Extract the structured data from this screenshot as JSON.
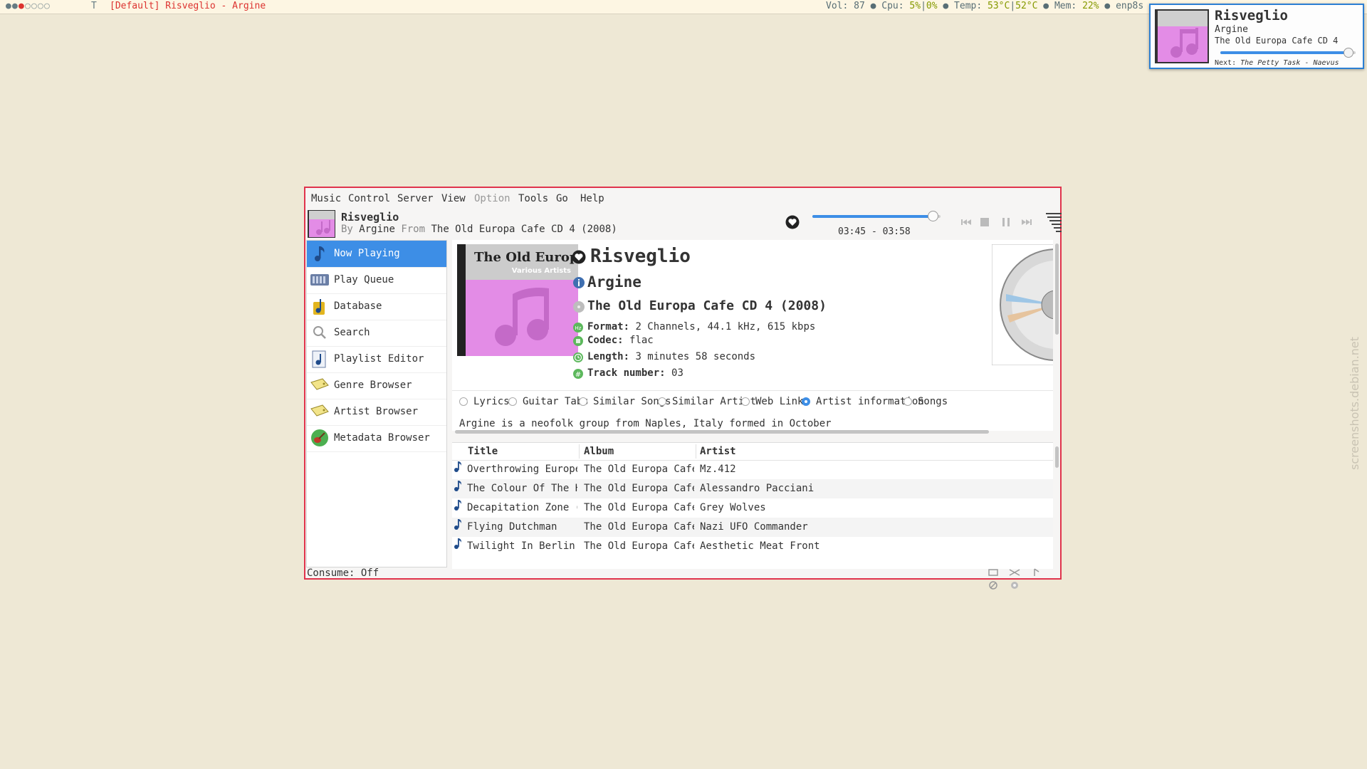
{
  "topbar": {
    "workspaces": [
      "●",
      "●",
      "●",
      "○",
      "○",
      "○",
      "○"
    ],
    "layout": "T",
    "window_title": "[Default] Risveglio - Argine",
    "vol_label": "Vol:",
    "vol": "87",
    "cpu_label": "Cpu:",
    "cpu1": "5%",
    "cpu2": "0%",
    "temp_label": "Temp:",
    "temp1": "53°C",
    "temp2": "52°C",
    "mem_label": "Mem:",
    "mem": "22%",
    "net": "enp8s"
  },
  "notification": {
    "title": "Risveglio",
    "artist": "Argine",
    "album": "The Old Europa Cafe CD 4",
    "progress": 0.94,
    "next_label": "Next:",
    "next_track": "The Petty Task - Naevus"
  },
  "watermark": "screenshots.debian.net",
  "menu": [
    "Music",
    "Control",
    "Server",
    "View",
    "Option",
    "Tools",
    "Go",
    "Help"
  ],
  "now_playing": {
    "title": "Risveglio",
    "by_label": "By",
    "artist": "Argine",
    "from_label": "From",
    "album": "The Old Europa Cafe CD 4 (2008)",
    "time": "03:45 - 03:58",
    "progress": 0.94
  },
  "cover": {
    "title": "The Old Europ",
    "subtitle": "Various Artists"
  },
  "sidebar": [
    {
      "label": "Now Playing",
      "selected": true
    },
    {
      "label": "Play Queue",
      "selected": false
    },
    {
      "label": "Database",
      "selected": false
    },
    {
      "label": "Search",
      "selected": false
    },
    {
      "label": "Playlist Editor",
      "selected": false
    },
    {
      "label": "Genre Browser",
      "selected": false
    },
    {
      "label": "Artist Browser",
      "selected": false
    },
    {
      "label": "Metadata Browser",
      "selected": false
    }
  ],
  "details": {
    "title": "Risveglio",
    "artist": "Argine",
    "album": "The Old Europa Cafe CD 4 (2008)",
    "format_label": "Format:",
    "format": "2 Channels, 44.1 kHz, 615 kbps",
    "codec_label": "Codec:",
    "codec": "flac",
    "length_label": "Length:",
    "length": "3 minutes 58 seconds",
    "track_label": "Track number:",
    "track": "03",
    "bio": "Argine is a neofolk group from Naples, Italy formed in October"
  },
  "tabs": [
    {
      "label": "Lyrics",
      "on": false
    },
    {
      "label": "Guitar Tabs",
      "on": false
    },
    {
      "label": "Similar Songs",
      "on": false
    },
    {
      "label": "Similar Artist",
      "on": false
    },
    {
      "label": "Web Links",
      "on": false
    },
    {
      "label": "Artist information",
      "on": true
    },
    {
      "label": "Songs",
      "on": false
    }
  ],
  "list": {
    "columns": [
      "Title",
      "Album",
      "Artist"
    ],
    "rows": [
      [
        "Overthrowing European …",
        "The Old Europa Cafe CD…",
        "Mz.412"
      ],
      [
        "The Colour Of The Huma…",
        "The Old Europa Cafe CD…",
        "Alessandro Pacciani"
      ],
      [
        "Decapitation Zone (Eur…",
        "The Old Europa Cafe CD…",
        "Grey Wolves"
      ],
      [
        "Flying Dutchman",
        "The Old Europa Cafe CD…",
        "Nazi UFO Commander"
      ],
      [
        "Twilight In Berlin",
        "The Old Europa Cafe CD…",
        "Aesthetic Meat Front"
      ]
    ]
  },
  "status": {
    "consume": "Consume: Off"
  },
  "icons": {
    "heart": "heart-icon",
    "prev": "previous-icon",
    "stop": "stop-icon",
    "pause": "pause-icon",
    "next": "next-icon",
    "menu": "menu-icon"
  },
  "colors": {
    "accent": "#3d8ee6",
    "window_border": "#e0334c",
    "desktop": "#eee8d5"
  }
}
